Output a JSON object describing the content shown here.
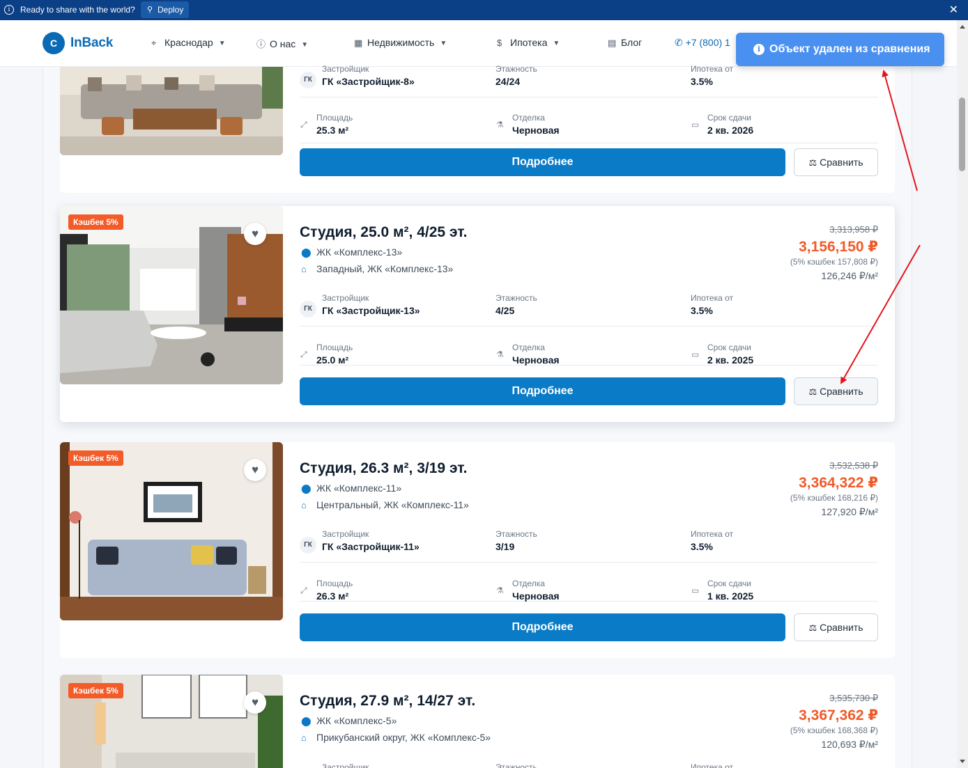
{
  "deploy_bar": {
    "text": "Ready to share with the world?",
    "button": "Deploy"
  },
  "header": {
    "logo_letter": "C",
    "logo": "InBack",
    "nav": [
      {
        "icon": "map-pin-icon",
        "label": "Краснодар"
      },
      {
        "icon": "info-icon",
        "label": "О нас"
      },
      {
        "icon": "building-icon",
        "label": "Недвижимость"
      },
      {
        "icon": "dollar-icon",
        "label": "Ипотека"
      },
      {
        "icon": "blog-icon",
        "label": "Блог"
      }
    ],
    "phone": "+7 (800) 1"
  },
  "toast": {
    "message": "Объект удален из сравнения"
  },
  "labels": {
    "developer": "Застройщик",
    "floors": "Этажность",
    "mortgage": "Ипотека от",
    "area": "Площадь",
    "finish": "Отделка",
    "deadline": "Срок сдачи",
    "details_button": "Подробнее",
    "compare_button": "Сравнить",
    "gk": "ГК"
  },
  "listings": [
    {
      "developer": "ГК «Застройщик-8»",
      "floors": "24/24",
      "mortgage": "3.5%",
      "area": "25.3 м²",
      "finish": "Черновая",
      "deadline": "2 кв. 2026"
    },
    {
      "cashback": "Кэшбек 5%",
      "title": "Студия, 25.0 м², 4/25 эт.",
      "complex": "ЖК «Комплекс-13»",
      "district": "Западный, ЖК «Комплекс-13»",
      "price_old": "3,313,958 ₽",
      "price_new": "3,156,150 ₽",
      "cashback_note": "(5% кэшбек 157,808 ₽)",
      "price_per_m2": "126,246 ₽/м²",
      "developer": "ГК «Застройщик-13»",
      "floors": "4/25",
      "mortgage": "3.5%",
      "area": "25.0 м²",
      "finish": "Черновая",
      "deadline": "2 кв. 2025"
    },
    {
      "cashback": "Кэшбек 5%",
      "title": "Студия, 26.3 м², 3/19 эт.",
      "complex": "ЖК «Комплекс-11»",
      "district": "Центральный, ЖК «Комплекс-11»",
      "price_old": "3,532,538 ₽",
      "price_new": "3,364,322 ₽",
      "cashback_note": "(5% кэшбек 168,216 ₽)",
      "price_per_m2": "127,920 ₽/м²",
      "developer": "ГК «Застройщик-11»",
      "floors": "3/19",
      "mortgage": "3.5%",
      "area": "26.3 м²",
      "finish": "Черновая",
      "deadline": "1 кв. 2025"
    },
    {
      "cashback": "Кэшбек 5%",
      "title": "Студия, 27.9 м², 14/27 эт.",
      "complex": "ЖК «Комплекс-5»",
      "district": "Прикубанский округ, ЖК «Комплекс-5»",
      "price_old": "3,535,730 ₽",
      "price_new": "3,367,362 ₽",
      "cashback_note": "(5% кэшбек 168,368 ₽)",
      "price_per_m2": "120,693 ₽/м²"
    }
  ],
  "colors": {
    "accent": "#0a7bc7",
    "price": "#f05a28",
    "cashback_badge": "#f35b29",
    "toast": "#4a90f0",
    "annotation": "#e5141b"
  }
}
